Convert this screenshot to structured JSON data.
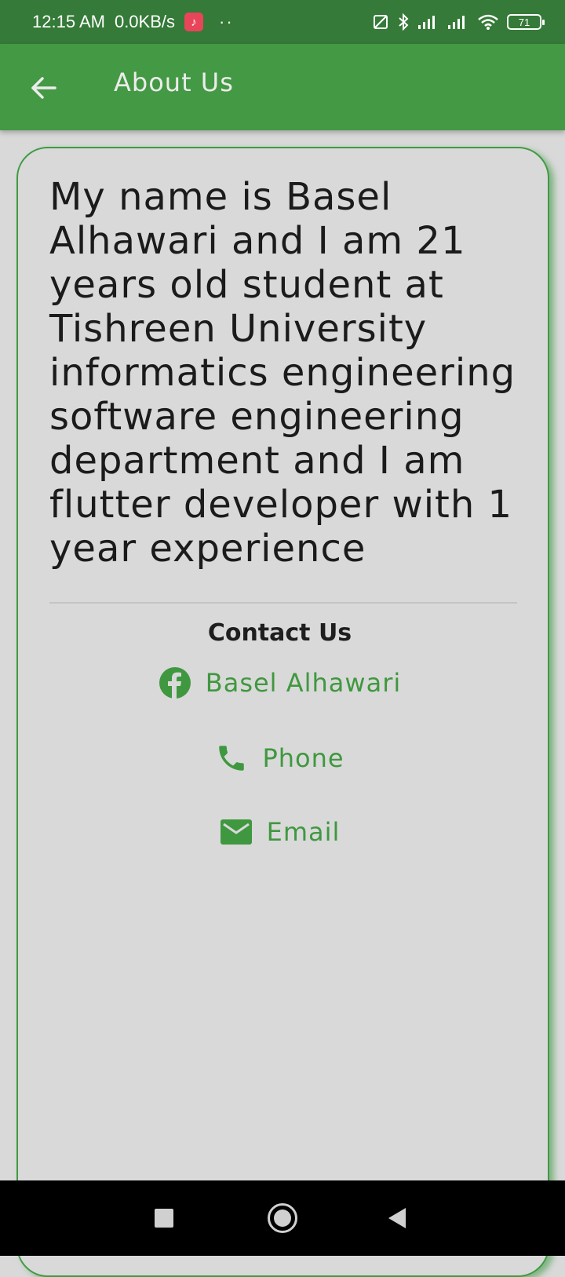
{
  "status_bar": {
    "time": "12:15 AM",
    "net_speed": "0.0KB/s",
    "dots": "··",
    "battery": "71"
  },
  "app_bar": {
    "title": "About Us",
    "back_icon": "arrow-back-icon"
  },
  "bio": {
    "text": "My name is Basel Alhawari and I am 21 years old student at Tishreen University informatics engineering software engineering department and I am flutter developer with 1 year experience"
  },
  "contact": {
    "title": "Contact Us",
    "items": [
      {
        "label": "Basel Alhawari",
        "icon": "facebook-icon"
      },
      {
        "label": "Phone",
        "icon": "phone-icon"
      },
      {
        "label": "Email",
        "icon": "email-icon"
      }
    ]
  },
  "colors": {
    "app_bar": "#449944",
    "status_bar": "#357a38",
    "accent": "#3f983f",
    "card_bg": "#d9d9d9"
  },
  "nav": {
    "recent_icon": "square-recents-icon",
    "home_icon": "circle-home-icon",
    "back_icon": "triangle-back-icon"
  }
}
